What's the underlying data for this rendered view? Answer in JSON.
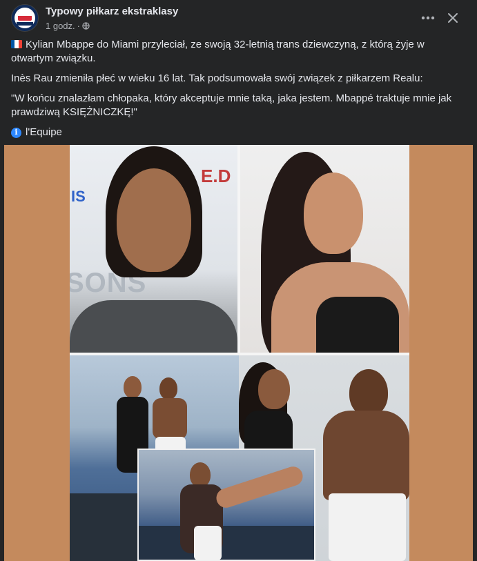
{
  "header": {
    "page_name": "Typowy piłkarz ekstraklasy",
    "time": "1 godz.",
    "dot": "·",
    "more_label": "···",
    "close_label": "✕",
    "avatar_icon": "page-logo-icon",
    "privacy_icon": "globe-icon"
  },
  "post": {
    "flag_icon": "france-flag-icon",
    "paragraph1": "Kylian Mbappe do Miami przyleciał, ze swoją 32-letnią trans dziewczyną, z którą żyje w otwartym związku.",
    "paragraph2": "Inès Rau zmieniła płeć w wieku 16 lat. Tak podsumowała swój związek z piłkarzem Realu:",
    "paragraph3": "\"W końcu znalazłam chłopaka, który akceptuje mnie taką, jaka jestem. Mbappé traktuje mnie jak prawdziwą KSIĘŻNICZKĘ!\"",
    "source_icon": "info-icon",
    "source_label": "l'Equipe"
  },
  "media": {
    "background_color": "#c48a5d",
    "watermark_left": "IS",
    "watermark_right": "E.D",
    "watermark_bottom": "SONS"
  },
  "colors": {
    "background": "#242526",
    "text": "#e4e6eb",
    "secondary_text": "#b0b3b8",
    "info_blue": "#2d88ff"
  }
}
